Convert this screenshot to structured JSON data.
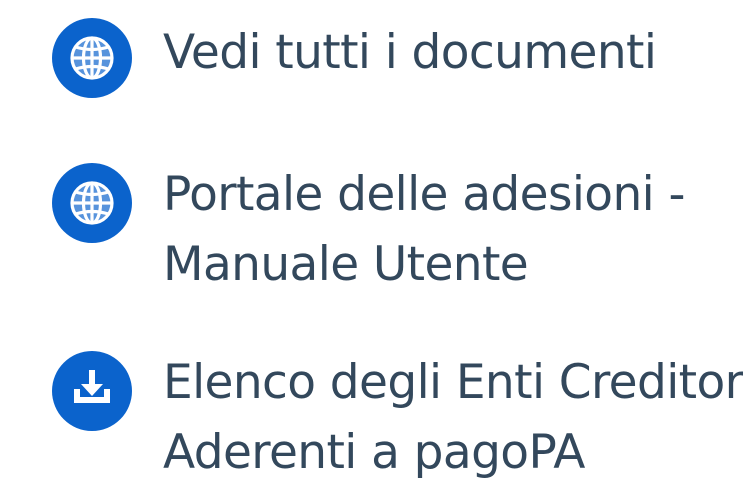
{
  "colors": {
    "accent": "#0b63cc",
    "text": "#33485c",
    "icon_glyph": "#ffffff"
  },
  "links": [
    {
      "icon": "globe-icon",
      "lines": [
        "Vedi tutti i documenti"
      ]
    },
    {
      "icon": "globe-icon",
      "lines": [
        "Portale delle adesioni -",
        "Manuale Utente"
      ]
    },
    {
      "icon": "download-icon",
      "lines": [
        "Elenco degli Enti Creditori",
        "Aderenti a pagoPA"
      ]
    }
  ]
}
